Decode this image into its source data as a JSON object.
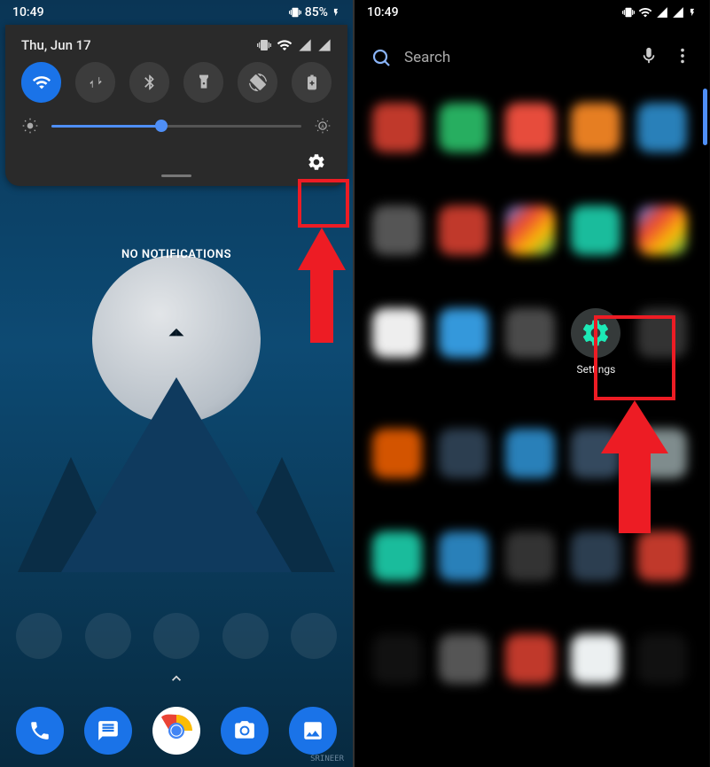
{
  "status_bar": {
    "time": "10:49",
    "battery": "85%"
  },
  "left": {
    "date": "Thu, Jun 17",
    "no_notifications": "NO NOTIFICATIONS",
    "brightness_pct": 44,
    "signature": "SRINEER",
    "qs": {
      "wifi": true,
      "data": false,
      "bt": false,
      "torch": false,
      "rotate": false,
      "battery": false
    }
  },
  "right": {
    "search_placeholder": "Search",
    "settings_label": "Settings"
  },
  "colors": {
    "accent": "#1a73e8",
    "annotation": "#ed1c24",
    "teal": "#1de9b6"
  }
}
